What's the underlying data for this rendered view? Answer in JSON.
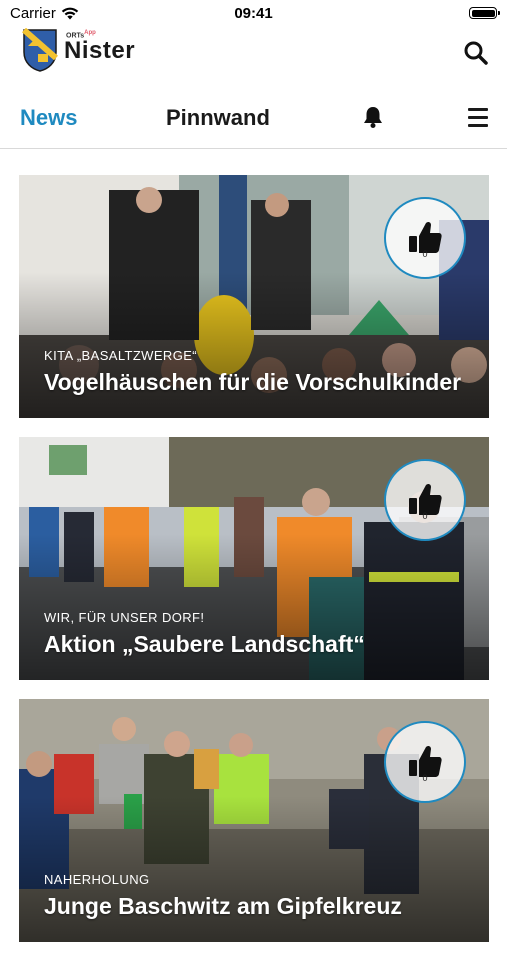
{
  "status_bar": {
    "carrier": "Carrier",
    "time": "09:41"
  },
  "header": {
    "logo_small": "ORTs",
    "logo_small_super": "App",
    "app_name": "Nister"
  },
  "tabs": {
    "news": "News",
    "pinnwand": "Pinnwand"
  },
  "colors": {
    "accent": "#1f8ac0",
    "text": "#1a1a1a"
  },
  "articles": [
    {
      "category": "KITA „BASALTZWERGE“",
      "title": "Vogelhäuschen für die Vorschulkinder",
      "likes": "0"
    },
    {
      "category": "WIR, FÜR UNSER DORF!",
      "title": "Aktion „Saubere Landschaft“",
      "likes": "0"
    },
    {
      "category": "NAHERHOLUNG",
      "title": "Junge Baschwitz am Gipfelkreuz",
      "likes": "0"
    }
  ]
}
